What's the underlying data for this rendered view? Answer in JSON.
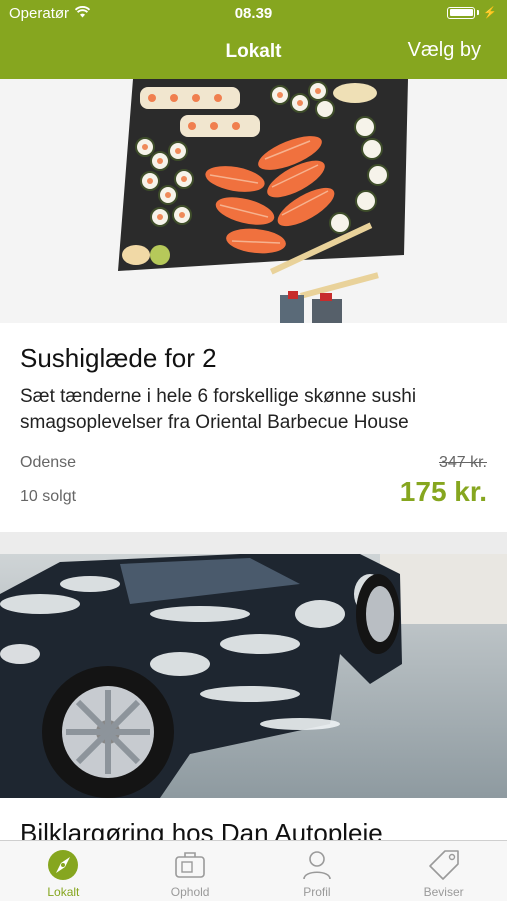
{
  "status_bar": {
    "carrier": "Operatør",
    "time": "08.39"
  },
  "nav": {
    "title": "Lokalt",
    "right_button": "Vælg by"
  },
  "deals": [
    {
      "title": "Sushiglæde for 2",
      "description": "Sæt tænderne i hele 6 forskellige skønne sushi smagsoplevelser fra Oriental Barbecue House",
      "city": "Odense",
      "sold": "10 solgt",
      "old_price": "347 kr.",
      "price": "175 kr."
    },
    {
      "title": "Bilklargøring hos Dan Autopleje"
    }
  ],
  "tabs": [
    {
      "label": "Lokalt",
      "icon": "compass-icon",
      "active": true
    },
    {
      "label": "Ophold",
      "icon": "suitcase-icon",
      "active": false
    },
    {
      "label": "Profil",
      "icon": "person-icon",
      "active": false
    },
    {
      "label": "Beviser",
      "icon": "tag-icon",
      "active": false
    }
  ],
  "colors": {
    "brand": "#86a61f",
    "tab_inactive": "#9a9a9a"
  }
}
